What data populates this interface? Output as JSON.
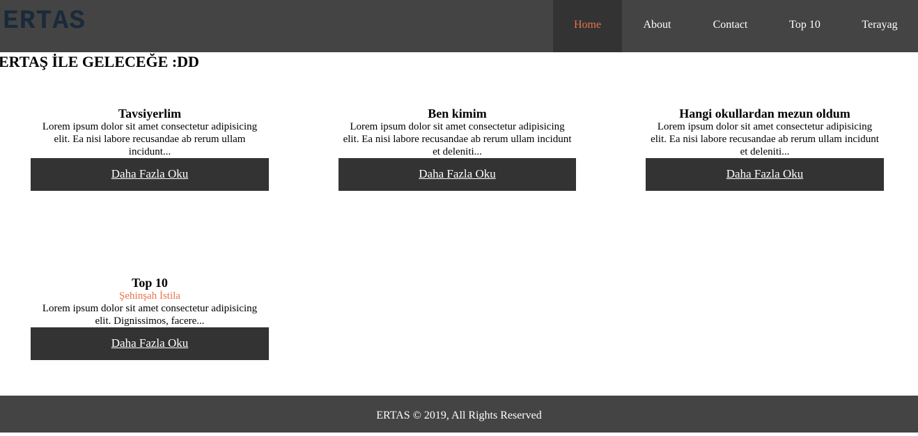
{
  "brand": {
    "logo": "ERTAS"
  },
  "nav": {
    "items": [
      {
        "label": "Home",
        "active": true
      },
      {
        "label": "About"
      },
      {
        "label": "Contact"
      },
      {
        "label": "Top 10"
      },
      {
        "label": "Terayag"
      }
    ]
  },
  "page": {
    "title": "ERTAŞ İLE GELECEĞE :DD"
  },
  "cards": [
    {
      "title": "Tavsiyerlim",
      "text": "Lorem ipsum dolor sit amet consectetur adipisicing elit. Ea nisi labore recusandae ab rerum ullam incidunt...",
      "button": "Daha Fazla Oku"
    },
    {
      "title": "Ben kimim",
      "text": "Lorem ipsum dolor sit amet consectetur adipisicing elit. Ea nisi labore recusandae ab rerum ullam incidunt et deleniti...",
      "button": "Daha Fazla Oku"
    },
    {
      "title": "Hangi okullardan mezun oldum",
      "text": "Lorem ipsum dolor sit amet consectetur adipisicing elit. Ea nisi labore recusandae ab rerum ullam incidunt et deleniti...",
      "button": "Daha Fazla Oku"
    },
    {
      "title": "Top 10",
      "subtitle": "Şehinşah İstila",
      "text": "Lorem ipsum dolor sit amet consectetur adipisicing elit. Dignissimos, facere...",
      "button": "Daha Fazla Oku"
    }
  ],
  "footer": {
    "text": "ERTAS © 2019, All Rights Reserved"
  },
  "colors": {
    "header_bg": "#444444",
    "active_nav": "#e8734a",
    "button_bg": "#333333"
  }
}
